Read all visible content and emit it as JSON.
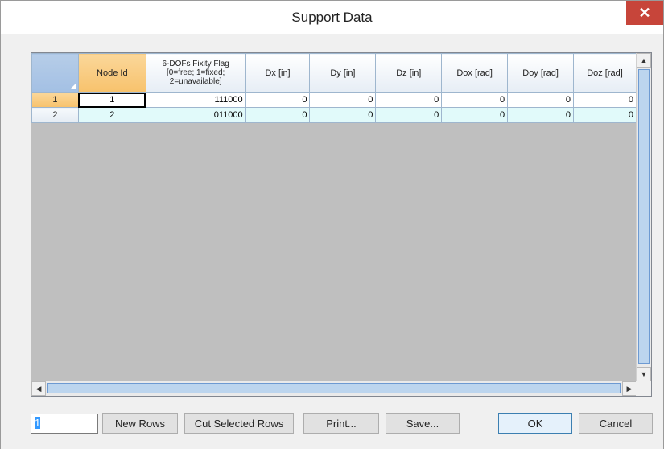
{
  "window": {
    "title": "Support Data",
    "close_glyph": "✕"
  },
  "grid": {
    "columns": [
      "Node Id",
      "6-DOFs Fixity Flag [0=free; 1=fixed; 2=unavailable]",
      "Dx [in]",
      "Dy [in]",
      "Dz [in]",
      "Dox [rad]",
      "Doy [rad]",
      "Doz [rad]"
    ],
    "rows": [
      {
        "num": "1",
        "cells": [
          "1",
          "111000",
          "0",
          "0",
          "0",
          "0",
          "0",
          "0"
        ]
      },
      {
        "num": "2",
        "cells": [
          "2",
          "011000",
          "0",
          "0",
          "0",
          "0",
          "0",
          "0"
        ]
      }
    ]
  },
  "scrollbars": {
    "up": "▲",
    "down": "▼",
    "left": "◀",
    "right": "▶"
  },
  "footer": {
    "row_count_value": "1",
    "new_rows": "New Rows",
    "cut_selected_rows": "Cut Selected Rows",
    "print": "Print...",
    "save": "Save...",
    "ok": "OK",
    "cancel": "Cancel"
  },
  "colors": {
    "active_header": "#f7c26c",
    "alt_row": "#e1fafa",
    "close_button": "#c7453a"
  }
}
